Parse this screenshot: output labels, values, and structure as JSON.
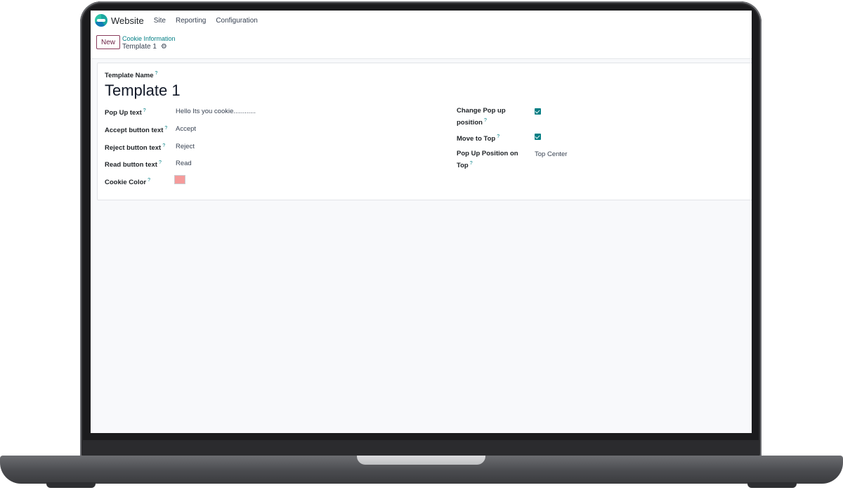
{
  "navbar": {
    "app_name": "Website",
    "menu": [
      "Site",
      "Reporting",
      "Configuration"
    ]
  },
  "control_panel": {
    "new_label": "New",
    "breadcrumb": "Cookie Information",
    "record_name": "Template 1"
  },
  "form": {
    "template_name_label": "Template Name",
    "template_name_value": "Template 1",
    "help_marker": "?",
    "left_fields": [
      {
        "label": "Pop Up text",
        "value": "Hello Its you cookie............"
      },
      {
        "label": "Accept button text",
        "value": "Accept"
      },
      {
        "label": "Reject button text",
        "value": "Reject"
      },
      {
        "label": "Read button text",
        "value": "Read"
      },
      {
        "label": "Cookie Color",
        "value": ""
      }
    ],
    "cookie_color": "#f59b9b",
    "right_fields": {
      "change_popup_position_label_1": "Change Pop up",
      "change_popup_position_label_2": "position",
      "change_popup_position_checked": true,
      "move_to_top_label": "Move to Top",
      "move_to_top_checked": true,
      "popup_position_on_top_label_1": "Pop Up Position on",
      "popup_position_on_top_label_2": "Top",
      "popup_position_on_top_value": "Top Center"
    }
  },
  "colors": {
    "accent": "#017e84",
    "new_button_border": "#8a3b5c"
  }
}
